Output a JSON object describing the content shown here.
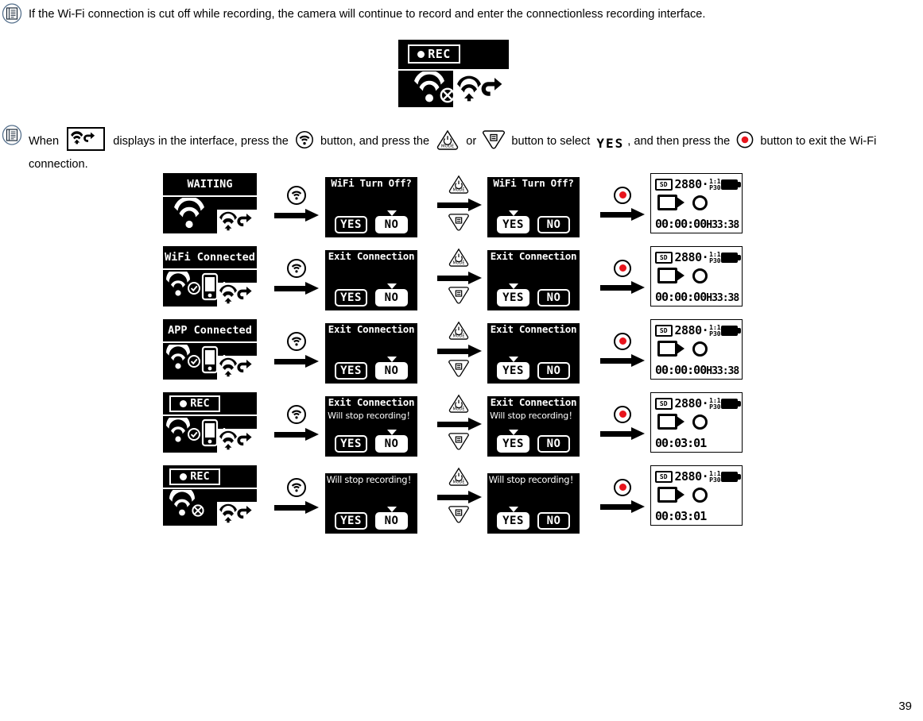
{
  "page": {
    "number": "39"
  },
  "notes": [
    {
      "icon": "note-icon",
      "text": "If the Wi-Fi connection is cut off while recording, the camera will continue to record and enter the connectionless recording interface."
    },
    {
      "icon": "note-icon",
      "seg1": "When ",
      "icon1": "wifi-upload-return-icon",
      "seg2": " displays in the interface, press the ",
      "icon2": "wifi-button-icon",
      "seg3": " button, and press the ",
      "icon3": "mode-button-icon",
      "seg4": " or ",
      "icon4": "menu-button-icon",
      "seg5": " button to select ",
      "yes_label": "YES",
      "seg6": ", and then press the ",
      "icon5": "record-button-icon",
      "seg7": " button to exit the Wi-Fi",
      "line2": "connection."
    }
  ],
  "top_display": {
    "rec_label": "REC",
    "icons": [
      "wifi-no-signal-icon",
      "wifi-upload-return-chip"
    ]
  },
  "buttons": {
    "wifi": "wifi-button-icon",
    "mode": "mode-button-icon",
    "mode_label": "MODE",
    "menu": "menu-button-icon",
    "record": "record-button-icon"
  },
  "dialog_options": {
    "yes": "YES",
    "no": "NO"
  },
  "final_screen_common": {
    "sd_label": "SD",
    "resolution": "2880",
    "dot": "·",
    "aspect": "1:1",
    "fps": "P30",
    "battery": "battery-full-icon",
    "camera": "camcorder-icon",
    "circle": "circle-icon"
  },
  "flow_rows": [
    {
      "status": {
        "type": "title",
        "title": "WAITING",
        "icons": [
          "wifi-searching-icon",
          "wifi-upload-return-chip"
        ]
      },
      "dialog1": {
        "title": "WiFi Turn Off?",
        "sub": "",
        "selected": "NO"
      },
      "dialog2": {
        "title": "WiFi Turn Off?",
        "sub": "",
        "selected": "YES"
      },
      "final": {
        "timecode": "00:00:00",
        "remaining": "H33:38"
      }
    },
    {
      "status": {
        "type": "title",
        "title": "WiFi Connected",
        "icons": [
          "wifi-icon",
          "check-icon",
          "phone-icon",
          "wifi-upload-return-chip"
        ]
      },
      "dialog1": {
        "title": "Exit Connection",
        "sub": "",
        "selected": "NO"
      },
      "dialog2": {
        "title": "Exit Connection",
        "sub": "",
        "selected": "YES"
      },
      "final": {
        "timecode": "00:00:00",
        "remaining": "H33:38"
      }
    },
    {
      "status": {
        "type": "title",
        "title": "APP Connected",
        "icons": [
          "wifi-icon",
          "check-icon",
          "phone-icon",
          "wifi-upload-return-chip"
        ]
      },
      "dialog1": {
        "title": "Exit Connection",
        "sub": "",
        "selected": "NO"
      },
      "dialog2": {
        "title": "Exit Connection",
        "sub": "",
        "selected": "YES"
      },
      "final": {
        "timecode": "00:00:00",
        "remaining": "H33:38"
      }
    },
    {
      "status": {
        "type": "rec",
        "title": "REC",
        "icons": [
          "wifi-icon",
          "check-icon",
          "phone-icon",
          "wifi-upload-return-chip"
        ]
      },
      "dialog1": {
        "title": "Exit Connection",
        "sub": "Will stop recording！",
        "selected": "NO"
      },
      "dialog2": {
        "title": "Exit Connection",
        "sub": "Will stop recording！",
        "selected": "YES"
      },
      "final": {
        "timecode": "00:03:01",
        "remaining": ""
      }
    },
    {
      "status": {
        "type": "rec",
        "title": "REC",
        "icons": [
          "wifi-no-signal-icon",
          "wifi-upload-return-chip"
        ]
      },
      "dialog1": {
        "title": "Will stop recording！",
        "sub": "",
        "selected": "NO"
      },
      "dialog2": {
        "title": "Will stop recording！",
        "sub": "",
        "selected": "YES"
      },
      "final": {
        "timecode": "00:03:01",
        "remaining": ""
      }
    }
  ],
  "colors": {
    "record_red": "#e8141c",
    "note_outline": "#4a5f7a",
    "screen_bg": "#000000"
  }
}
